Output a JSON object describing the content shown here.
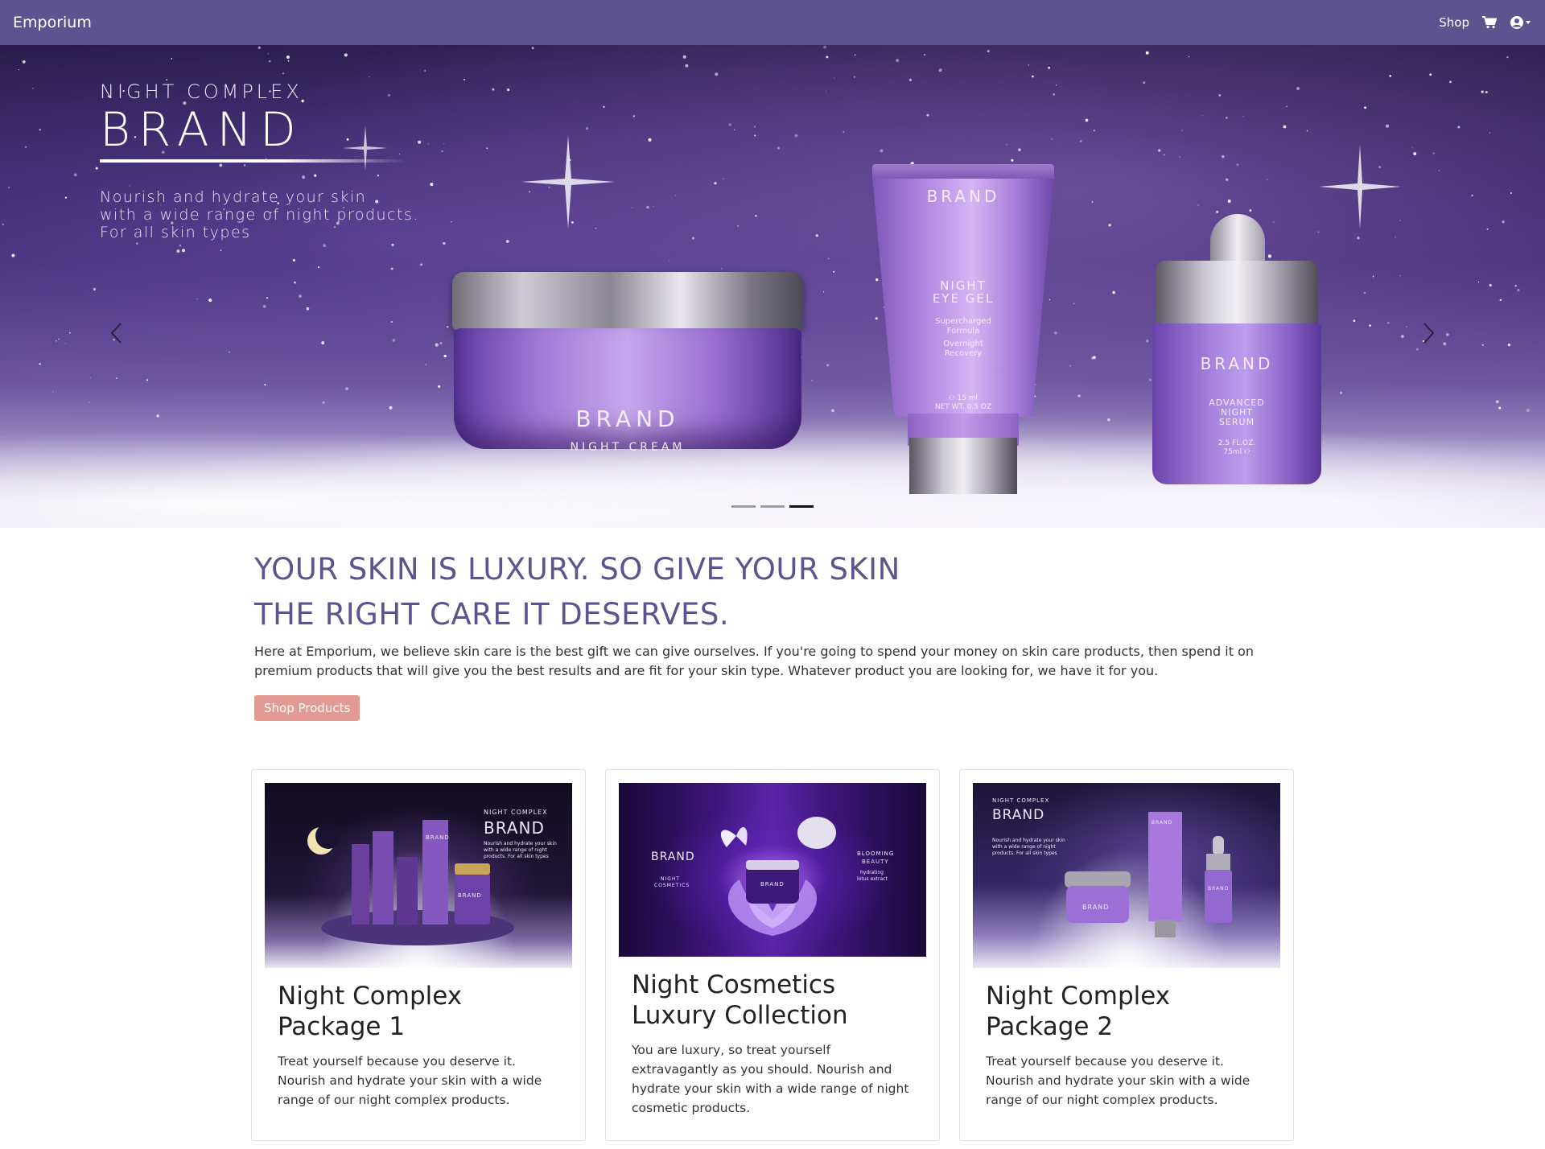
{
  "navbar": {
    "brand": "Emporium",
    "shop_link": "Shop",
    "cart_icon": "cart-icon",
    "user_icon": "user-circle-icon"
  },
  "hero": {
    "subtitle": "NIGHT COMPLEX",
    "brand": "BRAND",
    "description_lines": [
      "Nourish and hydrate your skin",
      "with a wide range of night products.",
      "For all skin types"
    ],
    "products": {
      "jar": {
        "brand": "BRAND",
        "name": "NIGHT CREAM"
      },
      "tube": {
        "brand": "BRAND",
        "name_line1": "NIGHT",
        "name_line2": "EYE GEL",
        "tag_line1": "Supercharged",
        "tag_line2": "Formula",
        "tag_line3": "Overnight",
        "tag_line4": "Recovery",
        "volume_line1": "℮ 15 ml",
        "volume_line2": "NET WT. 0.5 OZ"
      },
      "serum": {
        "brand": "BRAND",
        "name_line1": "ADVANCED",
        "name_line2": "NIGHT",
        "name_line3": "SERUM",
        "volume_line1": "2.5 FL.OZ.",
        "volume_line2": "75ml ℮"
      }
    },
    "slide_count": 3,
    "active_slide": 3,
    "prev_icon": "chevron-left-icon",
    "next_icon": "chevron-right-icon"
  },
  "intro": {
    "headline_line1": "YOUR SKIN IS LUXURY. SO GIVE YOUR SKIN",
    "headline_line2": "THE RIGHT CARE IT DESERVES.",
    "text": "Here at Emporium, we believe skin care is the best gift we can give ourselves. If you're going to spend your money on skin care products, then spend it on premium products that will give you the best results and are fit for your skin type. Whatever product you are looking for, we have it for you.",
    "button": "Shop Products"
  },
  "cards": [
    {
      "title_line1": "Night Complex",
      "title_line2": "Package 1",
      "text": "Treat yourself because you deserve it. Nourish and hydrate your skin with a wide range of our night complex products.",
      "image": {
        "heading_small": "NIGHT COMPLEX",
        "heading": "BRAND",
        "blurb": "Nourish and hydrate your skin with a wide range of night products. For all skin types",
        "product_brand": "BRAND",
        "product_brand_2": "BRAND"
      }
    },
    {
      "title_line1": "Night Cosmetics",
      "title_line2": "Luxury Collection",
      "text": "You are luxury, so treat yourself extravagantly as you should. Nourish and hydrate your skin with a wide range of night cosmetic products.",
      "image": {
        "left_heading": "BRAND",
        "left_sub_line1": "NIGHT",
        "left_sub_line2": "COSMETICS",
        "right_line1": "BLOOMING",
        "right_line2": "BEAUTY",
        "right_line3": "hydrating",
        "right_line4": "lotus extract",
        "jar_label": "BRAND"
      }
    },
    {
      "title_line1": "Night Complex",
      "title_line2": "Package 2",
      "text": "Treat yourself because you deserve it. Nourish and hydrate your skin with a wide range of our night complex products.",
      "image": {
        "heading_small": "NIGHT COMPLEX",
        "heading": "BRAND",
        "blurb": "Nourish and hydrate your skin with a wide range of night products. For all skin types",
        "jar_label": "BRAND",
        "tube_label": "BRAND",
        "serum_label": "BRAND"
      }
    }
  ],
  "colors": {
    "navbar": "#5d538f",
    "headline": "#5d538f",
    "button": "#e39a92"
  }
}
